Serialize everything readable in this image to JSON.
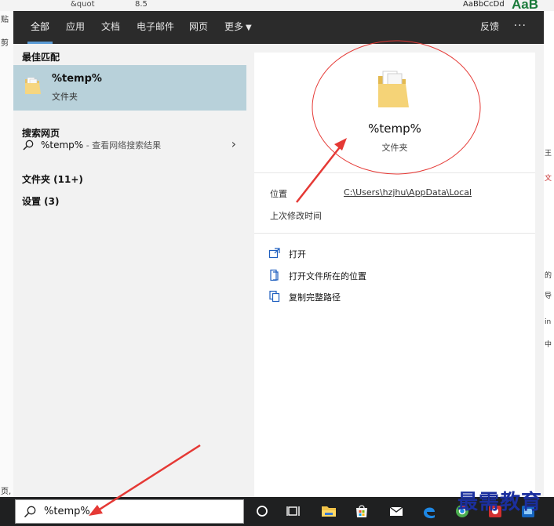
{
  "background": {
    "font_name": "&quot",
    "font_size": "8.5",
    "style_preview": "AaBbCcDd",
    "style_preview2": "AaB",
    "left_fragments": [
      "贴",
      "剪",
      "页,"
    ],
    "right_fragments": [
      "王",
      "文",
      "的",
      "导",
      "in",
      "中"
    ]
  },
  "tabs": [
    {
      "label": "全部",
      "active": true
    },
    {
      "label": "应用"
    },
    {
      "label": "文档"
    },
    {
      "label": "电子邮件"
    },
    {
      "label": "网页"
    },
    {
      "label": "更多"
    }
  ],
  "feedback_label": "反馈",
  "more_options": "···",
  "left": {
    "best_match_header": "最佳匹配",
    "best_match": {
      "title": "%temp%",
      "subtitle": "文件夹",
      "icon": "folder-icon"
    },
    "web_header": "搜索网页",
    "web_result": {
      "query": "%temp%",
      "desc": " - 查看网络搜索结果"
    },
    "folders_header": "文件夹 (11+)",
    "settings_header": "设置 (3)"
  },
  "right": {
    "title": "%temp%",
    "subtitle": "文件夹",
    "location_label": "位置",
    "location_value": "C:\\Users\\hzjhu\\AppData\\Local",
    "modified_label": "上次修改时间",
    "actions": [
      {
        "label": "打开",
        "icon": "open-icon"
      },
      {
        "label": "打开文件所在的位置",
        "icon": "file-location-icon"
      },
      {
        "label": "复制完整路径",
        "icon": "copy-path-icon"
      }
    ]
  },
  "taskbar": {
    "search_value": "%temp%",
    "icons": [
      "cortana-icon",
      "task-view-icon",
      "file-explorer-icon",
      "store-icon",
      "mail-icon",
      "edge-icon",
      "chrome-icon",
      "app-icon",
      "app2-icon"
    ]
  },
  "watermark": "最需教育",
  "colors": {
    "accent": "#5b9bd5",
    "selected": "#b8d1da",
    "annotation": "#e53935",
    "taskbar": "#1f2021"
  }
}
